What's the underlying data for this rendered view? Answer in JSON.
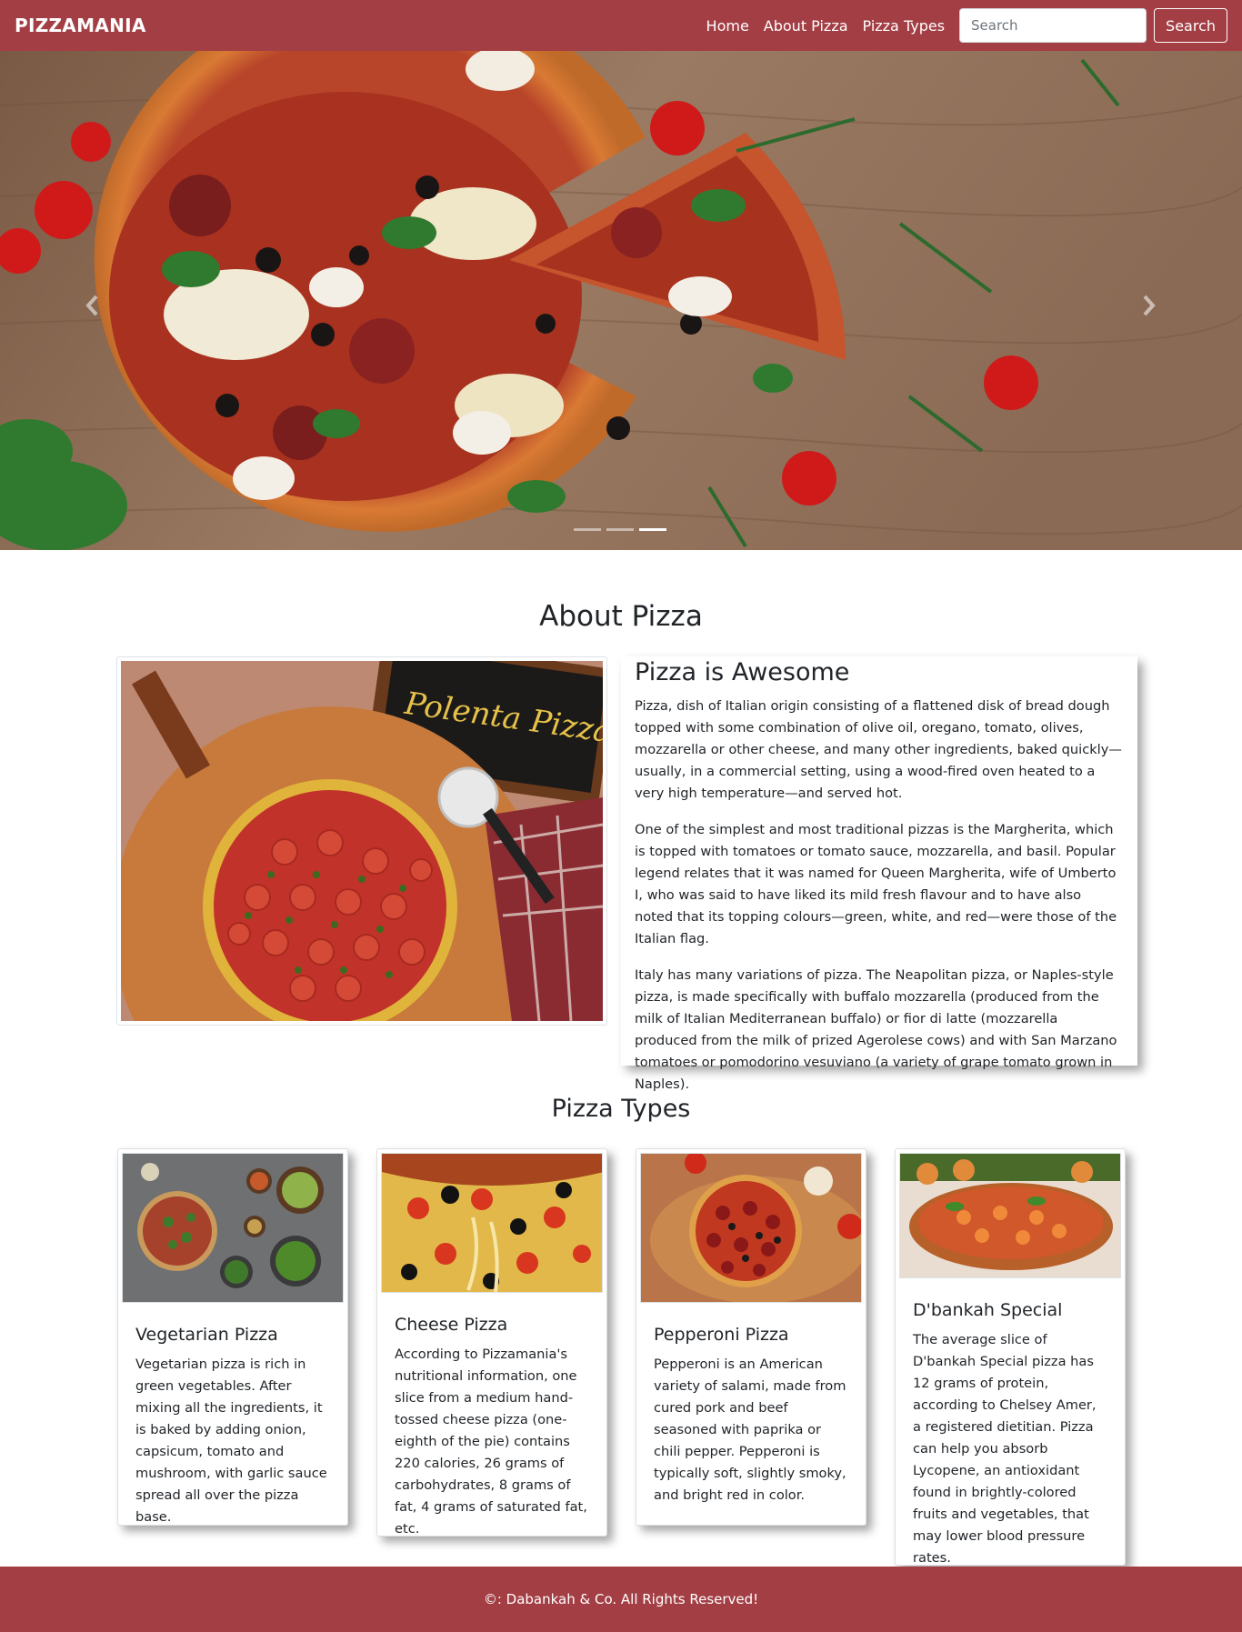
{
  "navbar": {
    "brand": "PIZZAMANIA",
    "links": [
      "Home",
      "About Pizza",
      "Pizza Types"
    ],
    "search_placeholder": "Search",
    "search_button": "Search"
  },
  "carousel": {
    "active_index": 2,
    "slide_count": 3
  },
  "about": {
    "heading": "About Pizza",
    "card_title": "Pizza is Awesome",
    "image_text": "Polenta Pizza",
    "paragraphs": [
      "Pizza, dish of Italian origin consisting of a flattened disk of bread dough topped with some combination of olive oil, oregano, tomato, olives, mozzarella or other cheese, and many other ingredients, baked quickly—usually, in a commercial setting, using a wood-fired oven heated to a very high temperature—and served hot.",
      "One of the simplest and most traditional pizzas is the Margherita, which is topped with tomatoes or tomato sauce, mozzarella, and basil. Popular legend relates that it was named for Queen Margherita, wife of Umberto I, who was said to have liked its mild fresh flavour and to have also noted that its topping colours—green, white, and red—were those of the Italian flag.",
      "Italy has many variations of pizza. The Neapolitan pizza, or Naples-style pizza, is made specifically with buffalo mozzarella (produced from the milk of Italian Mediterranean buffalo) or fior di latte (mozzarella produced from the milk of prized Agerolese cows) and with San Marzano tomatoes or pomodorino vesuviano (a variety of grape tomato grown in Naples)."
    ]
  },
  "types": {
    "heading": "Pizza Types",
    "cards": [
      {
        "title": "Vegetarian Pizza",
        "text": "Vegetarian pizza is rich in green vegetables. After mixing all the ingredients, it is baked by adding onion, capsicum, tomato and mushroom, with garlic sauce spread all over the pizza base."
      },
      {
        "title": "Cheese Pizza",
        "text": "According to Pizzamania's nutritional information, one slice from a medium hand-tossed cheese pizza (one-eighth of the pie) contains 220 calories, 26 grams of carbohydrates, 8 grams of fat, 4 grams of saturated fat, etc."
      },
      {
        "title": "Pepperoni Pizza",
        "text": "Pepperoni is an American variety of salami, made from cured pork and beef seasoned with paprika or chili pepper. Pepperoni is typically soft, slightly smoky, and bright red in color."
      },
      {
        "title": "D'bankah Special",
        "text": "The average slice of D'bankah Special pizza has 12 grams of protein, according to Chelsey Amer, a registered dietitian. Pizza can help you absorb Lycopene, an antioxidant found in brightly-colored fruits and vegetables, that may lower blood pressure rates."
      }
    ]
  },
  "footer": {
    "text": "©: Dabankah & Co. All Rights Reserved!"
  },
  "colors": {
    "brand": "#a33e44",
    "text": "#212529"
  }
}
